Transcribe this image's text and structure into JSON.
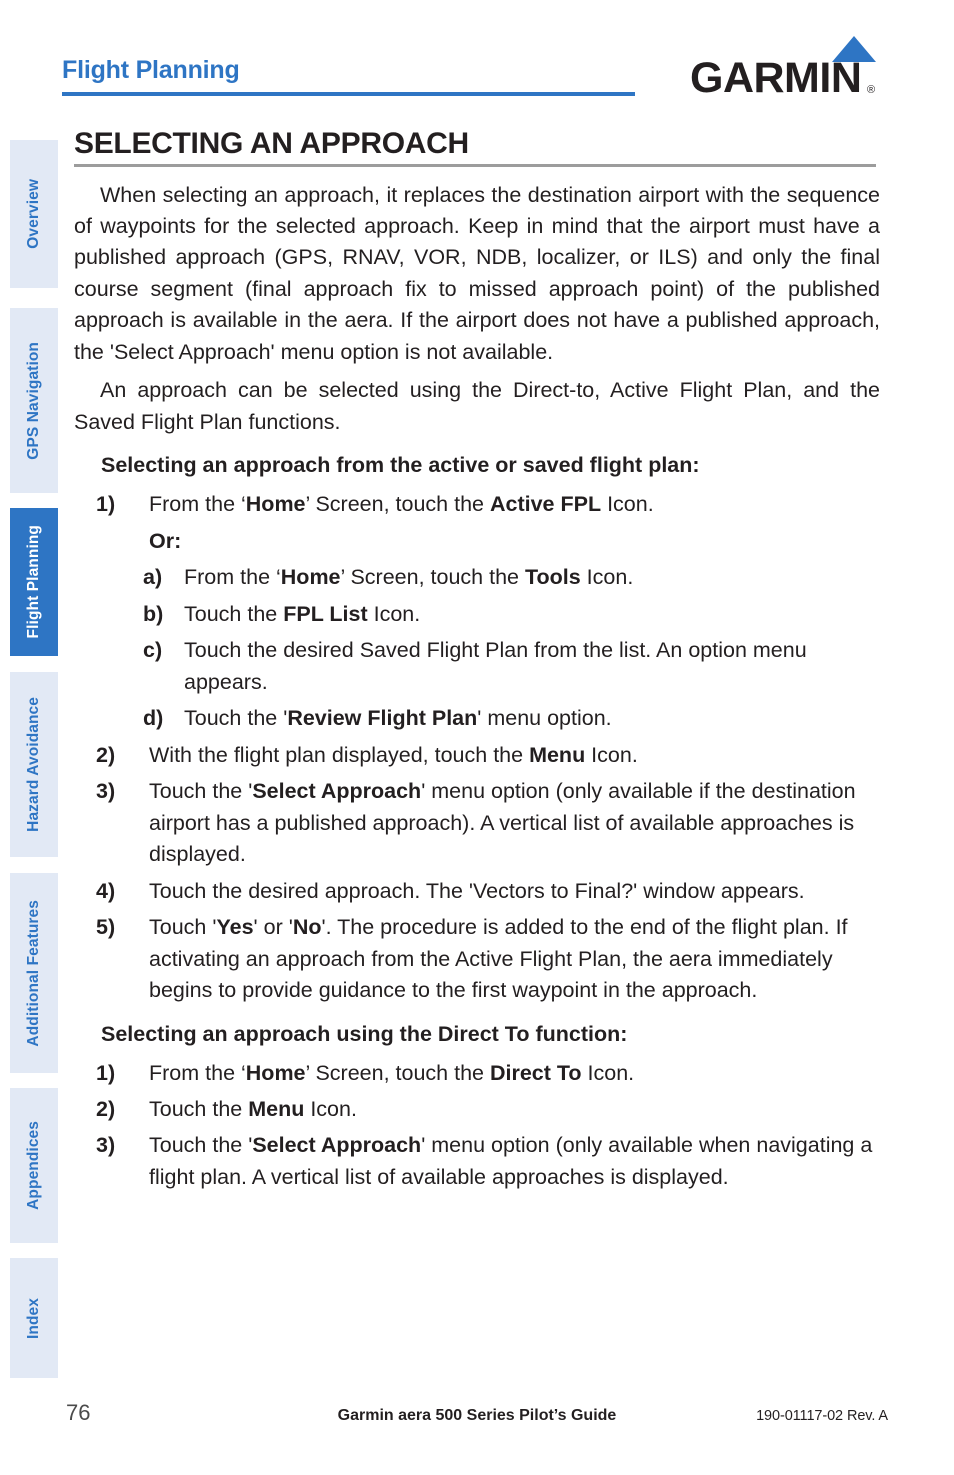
{
  "header": {
    "chapter_title": "Flight Planning",
    "brand": {
      "wordmark": "GARMIN",
      "registered_mark": "®",
      "triangle_color": "#2e75c4"
    },
    "rule_color": "#2e75c4"
  },
  "sidebar": {
    "tabs": [
      {
        "label": "Overview",
        "active": false
      },
      {
        "label": "GPS Navigation",
        "active": false
      },
      {
        "label": "Flight Planning",
        "active": true
      },
      {
        "label": "Hazard Avoidance",
        "active": false
      },
      {
        "label": "Additional Features",
        "active": false
      },
      {
        "label": "Appendices",
        "active": false
      },
      {
        "label": "Index",
        "active": false
      }
    ],
    "active_bg": "#2e75c4",
    "inactive_bg": "#e2e9f5",
    "text_color": "#2e75c4"
  },
  "main": {
    "section_title": "SELECTING AN APPROACH",
    "paragraphs": [
      "When selecting an approach, it replaces the destination airport with the sequence of waypoints for the selected approach.  Keep in mind that the airport must have a published approach (GPS, RNAV, VOR, NDB, localizer, or ILS) and only the final course segment (final approach fix to missed approach point) of the published approach is available in the aera.  If the airport does not have a published approach, the 'Select Approach' menu option is not available.",
      "An approach can be selected using the Direct-to, Active Flight Plan, and the Saved Flight Plan functions."
    ],
    "procedures": [
      {
        "heading": "Selecting an approach from the active or saved flight plan:",
        "steps": [
          {
            "level": 1,
            "marker": "1)",
            "html": "From the ‘<b>Home</b>’ Screen, touch the <b>Active FPL</b> Icon."
          },
          {
            "level": 0,
            "marker": "",
            "html": "<b>Or:</b>"
          },
          {
            "level": 2,
            "marker": "a)",
            "html": "From the ‘<b>Home</b>’ Screen, touch the <b>Tools</b> Icon."
          },
          {
            "level": 2,
            "marker": "b)",
            "html": "Touch the <b>FPL List</b> Icon."
          },
          {
            "level": 2,
            "marker": "c)",
            "html": "Touch the desired Saved Flight Plan from the list.  An option menu appears."
          },
          {
            "level": 2,
            "marker": "d)",
            "html": "Touch the '<b>Review Flight Plan</b>' menu option."
          },
          {
            "level": 1,
            "marker": "2)",
            "html": "With the flight plan displayed, touch the <b>Menu</b> Icon."
          },
          {
            "level": 1,
            "marker": "3)",
            "html": "Touch the '<b>Select Approach</b>' menu option (only available if the destination airport has a published approach).  A vertical list of available approaches is displayed."
          },
          {
            "level": 1,
            "marker": "4)",
            "html": "Touch the desired approach.  The 'Vectors to Final?' window appears."
          },
          {
            "level": 1,
            "marker": "5)",
            "html": "Touch '<b>Yes</b>' or '<b>No</b>'.  The procedure is added to the end of the flight plan. If activating an approach from the Active Flight Plan, the aera immediately begins to provide guidance to the first waypoint in the approach."
          }
        ]
      },
      {
        "heading": "Selecting an approach using the Direct To function:",
        "steps": [
          {
            "level": 1,
            "marker": "1)",
            "html": "From the ‘<b>Home</b>’ Screen, touch the <b>Direct To</b> Icon."
          },
          {
            "level": 1,
            "marker": "2)",
            "html": "Touch the <b>Menu</b> Icon."
          },
          {
            "level": 1,
            "marker": "3)",
            "html": "Touch the '<b>Select Approach</b>' menu option (only available when navigating a flight plan.  A vertical list of available approaches is displayed."
          }
        ]
      }
    ]
  },
  "footer": {
    "page_number": "76",
    "title": "Garmin aera 500 Series Pilot’s Guide",
    "part_number": "190-01117-02  Rev. A"
  }
}
